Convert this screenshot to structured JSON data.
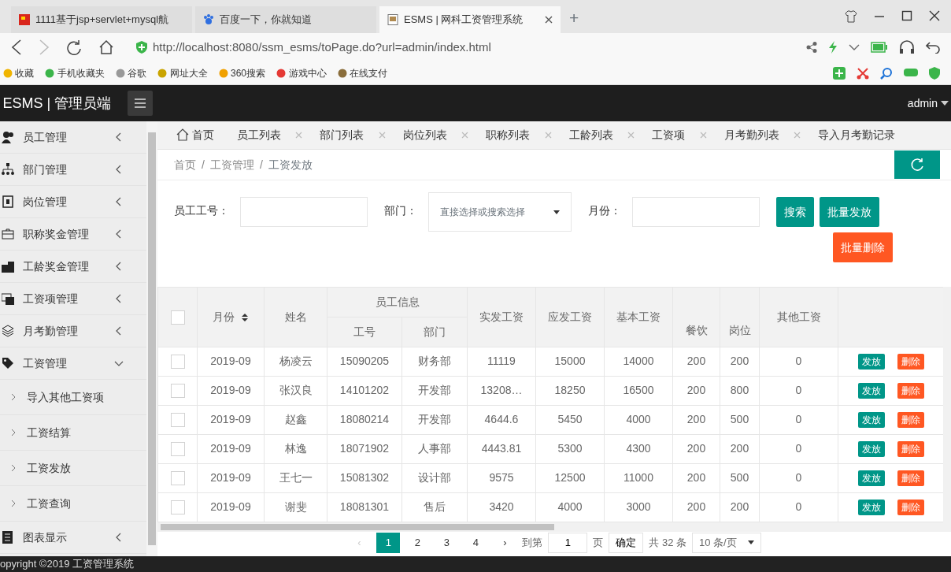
{
  "browser": {
    "tabs": [
      {
        "title": "1111基于jsp+servlet+mysql航",
        "selected": false
      },
      {
        "title": "百度一下，你就知道",
        "selected": false
      },
      {
        "title": "ESMS | 网科工资管理系统",
        "selected": true
      }
    ],
    "new_tab": "+",
    "url": "http://localhost:8080/ssm_esms/toPage.do?url=admin/index.html",
    "bookmarks": [
      "收藏",
      "手机收藏夹",
      "谷歌",
      "网址大全",
      "360搜索",
      "游戏中心",
      "在线支付"
    ]
  },
  "app": {
    "brand": "ESMS | 管理员端",
    "user": "admin"
  },
  "sidebar": {
    "items": [
      {
        "label": "员工管理",
        "expanded": false
      },
      {
        "label": "部门管理",
        "expanded": false
      },
      {
        "label": "岗位管理",
        "expanded": false
      },
      {
        "label": "职称奖金管理",
        "expanded": false
      },
      {
        "label": "工龄奖金管理",
        "expanded": false
      },
      {
        "label": "工资项管理",
        "expanded": false
      },
      {
        "label": "月考勤管理",
        "expanded": false
      },
      {
        "label": "工资管理",
        "expanded": true,
        "children": [
          {
            "label": "导入其他工资项"
          },
          {
            "label": "工资结算"
          },
          {
            "label": "工资发放"
          },
          {
            "label": "工资查询"
          }
        ]
      },
      {
        "label": "图表显示",
        "expanded": false
      }
    ]
  },
  "page_tabs": [
    {
      "label": "首页",
      "kind": "home",
      "selected": false
    },
    {
      "label": "员工列表",
      "kind": "closable",
      "selected": false
    },
    {
      "label": "部门列表",
      "kind": "closable",
      "selected": false
    },
    {
      "label": "岗位列表",
      "kind": "closable",
      "selected": false
    },
    {
      "label": "职称列表",
      "kind": "closable",
      "selected": false
    },
    {
      "label": "工龄列表",
      "kind": "closable",
      "selected": false
    },
    {
      "label": "工资项",
      "kind": "closable",
      "selected": false
    },
    {
      "label": "月考勤列表",
      "kind": "closable",
      "selected": false
    },
    {
      "label": "导入月考勤记录",
      "kind": "plain",
      "selected": false
    }
  ],
  "breadcrumb": [
    {
      "kind": "link",
      "label": "首页"
    },
    {
      "kind": "separator",
      "label": "/"
    },
    {
      "kind": "link",
      "label": "工资管理"
    },
    {
      "kind": "separator",
      "label": "/"
    },
    {
      "kind": "current",
      "label": "工资发放"
    }
  ],
  "search": {
    "fields": [
      {
        "label": "员工工号：",
        "kind": "text"
      },
      {
        "label": "部门：",
        "kind": "select",
        "placeholder": "直接选择或搜索选择"
      },
      {
        "label": "月份：",
        "kind": "text"
      }
    ],
    "buttons": [
      {
        "label": "搜索",
        "kind": "primary"
      },
      {
        "label": "批量发放",
        "kind": "primary"
      },
      {
        "label": "批量删除",
        "kind": "danger"
      }
    ]
  },
  "table": {
    "select_all": {
      "checked": false
    },
    "columns": [
      {
        "kind": "single",
        "label": "月份",
        "sortable": true
      },
      {
        "kind": "single",
        "label": "姓名"
      },
      {
        "kind": "group",
        "label": "员工信息",
        "colspan": 2,
        "children": [
          {
            "label": "工号"
          },
          {
            "label": "部门"
          }
        ]
      },
      {
        "kind": "single",
        "label": "实发工资"
      },
      {
        "kind": "single",
        "label": "应发工资"
      },
      {
        "kind": "single",
        "label": "基本工资"
      },
      {
        "kind": "bottom",
        "label": "餐饮"
      },
      {
        "kind": "bottom",
        "label": "岗位"
      },
      {
        "kind": "single",
        "label": "其他工资"
      }
    ],
    "rows": [
      {
        "checked": false,
        "cells": [
          "2019-09",
          "杨凌云",
          "15090205",
          "财务部",
          "11119",
          "15000",
          "14000",
          "200",
          "200",
          "0"
        ],
        "actions": [
          "发放",
          "删除"
        ]
      },
      {
        "checked": false,
        "cells": [
          "2019-09",
          "张汉良",
          "14101202",
          "开发部",
          "13208…",
          "18250",
          "16500",
          "200",
          "800",
          "0"
        ],
        "actions": [
          "发放",
          "删除"
        ]
      },
      {
        "checked": false,
        "cells": [
          "2019-09",
          "赵鑫",
          "18080214",
          "开发部",
          "4644.6",
          "5450",
          "4000",
          "200",
          "500",
          "0"
        ],
        "actions": [
          "发放",
          "删除"
        ]
      },
      {
        "checked": false,
        "cells": [
          "2019-09",
          "林逸",
          "18071902",
          "人事部",
          "4443.81",
          "5300",
          "4300",
          "200",
          "200",
          "0"
        ],
        "actions": [
          "发放",
          "删除"
        ]
      },
      {
        "checked": false,
        "cells": [
          "2019-09",
          "王七一",
          "15081302",
          "设计部",
          "9575",
          "12500",
          "11000",
          "200",
          "500",
          "0"
        ],
        "actions": [
          "发放",
          "删除"
        ]
      },
      {
        "checked": false,
        "cells": [
          "2019-09",
          "谢斐",
          "18081301",
          "售后",
          "3420",
          "4000",
          "3000",
          "200",
          "200",
          "0"
        ],
        "actions": [
          "发放",
          "删除"
        ]
      }
    ]
  },
  "pagination": {
    "prev": {
      "label": "‹",
      "disabled": true
    },
    "pages": [
      {
        "label": "1",
        "selected": true
      },
      {
        "label": "2",
        "selected": false
      },
      {
        "label": "3",
        "selected": false
      },
      {
        "label": "4",
        "selected": false
      }
    ],
    "next": {
      "label": "›",
      "disabled": false
    },
    "goto_label": "到第",
    "goto_value": "1",
    "page_suffix": "页",
    "confirm": "确定",
    "total": "共 32 条",
    "page_size": "10 条/页"
  },
  "footer": "opyright ©2019 工资管理系统"
}
